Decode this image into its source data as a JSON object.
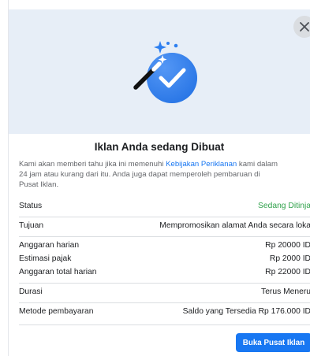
{
  "dialog": {
    "title": "Iklan Anda sedang Dibuat",
    "description": {
      "line1_before": "Kami akan memberi tahu jika ini memenuhi ",
      "policy_link": "Kebijakan Periklanan",
      "line1_after": " kami dalam",
      "line2": "24 jam atau kurang dari itu. Anda juga dapat memperoleh pembaruan di",
      "line3": "Pusat Iklan."
    },
    "details": {
      "status_label": "Status",
      "status_value": "Sedang Ditinja",
      "objective_label": "Tujuan",
      "objective_value": "Mempromosikan alamat Anda secara loka",
      "daily_budget_label": "Anggaran harian",
      "daily_budget_value": "Rp 20000 ID",
      "tax_label": "Estimasi pajak",
      "tax_value": "Rp 2000 ID",
      "total_label": "Anggaran total harian",
      "total_value": "Rp 22000 ID",
      "duration_label": "Durasi",
      "duration_value": "Terus Meneru",
      "payment_label": "Metode pembayaran",
      "payment_value": "Saldo yang Tersedia Rp 176.000 ID"
    },
    "primary_button": "Buka Pusat Iklan",
    "close_icon": "close-icon",
    "illustration_icon": "magic-wand-checkmark-icon"
  },
  "colors": {
    "hero_bg": "#e7eef7",
    "accent": "#1877f2",
    "status_green": "#31a24c"
  }
}
